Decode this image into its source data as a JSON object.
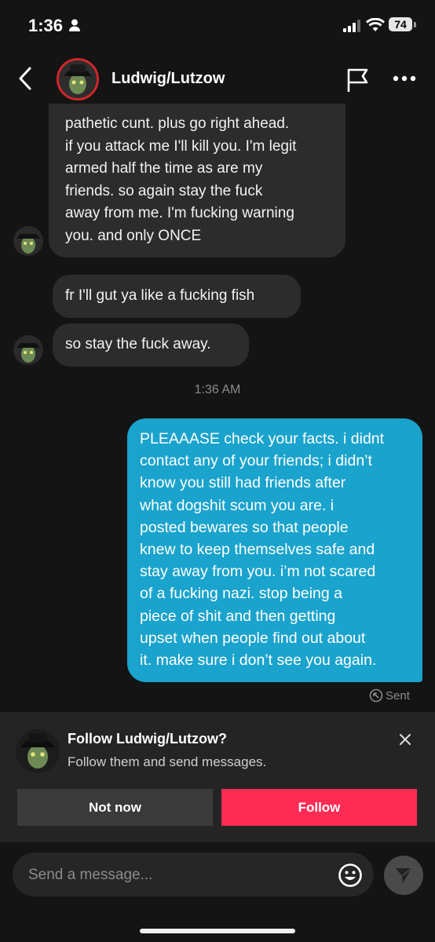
{
  "status_bar": {
    "time": "1:36",
    "battery": "74"
  },
  "header": {
    "contact_name": "Ludwig/Lutzow"
  },
  "messages": {
    "incoming_1": "pathetic cunt. plus go right ahead.\nif you attack me I'll kill you. I'm legit\narmed half the time as are my\nfriends. so again stay the fuck\naway from me. I'm fucking warning\nyou. and only ONCE",
    "incoming_2": "fr I'll gut ya like a fucking fish",
    "incoming_3": "so stay the fuck away.",
    "timestamp": "1:36 AM",
    "outgoing_1": "PLEAAASE check your facts. i didnt\ncontact any of your friends; i didn’t\nknow you still had friends after\nwhat dogshit scum you are. i\nposted bewares so that people\nknew to keep themselves safe and\nstay away from you. i’m not scared\nof a fucking nazi. stop being a\npiece of shit and then getting\nupset when people find out about\nit. make sure i don’t see you again.",
    "outgoing_status": "Sent"
  },
  "follow_prompt": {
    "title": "Follow Ludwig/Lutzow?",
    "subtitle": "Follow them and send messages.",
    "not_now_label": "Not now",
    "follow_label": "Follow"
  },
  "composer": {
    "placeholder": "Send a message..."
  },
  "colors": {
    "outgoing_bubble": "#1aa3cc",
    "follow_button": "#fd2c55",
    "background": "#141414",
    "incoming_bubble": "#2c2c2c"
  },
  "icons": [
    "person-icon",
    "signal-icon",
    "wifi-icon",
    "battery-icon",
    "back-chevron-icon",
    "flag-icon",
    "more-icon",
    "sent-icon",
    "close-icon",
    "emoji-icon",
    "send-icon"
  ]
}
